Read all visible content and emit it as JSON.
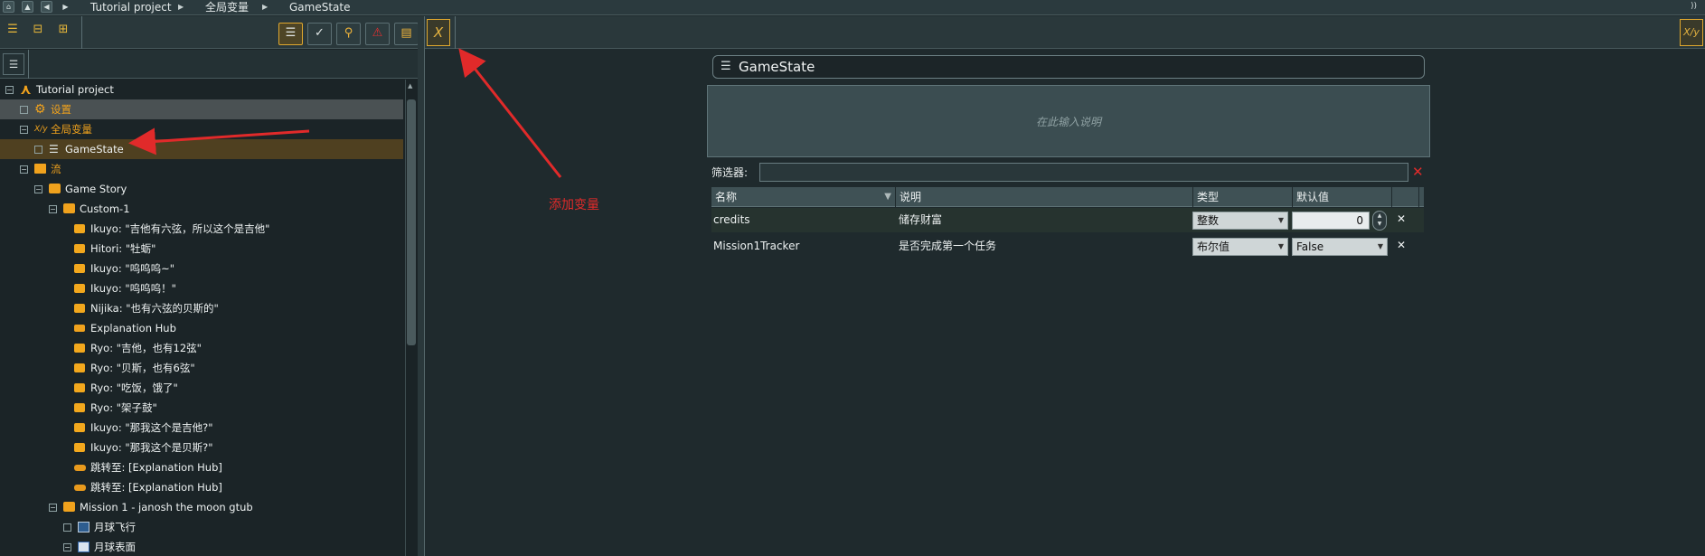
{
  "breadcrumb": {
    "items": [
      "Tutorial project",
      "全局变量",
      "GameState"
    ]
  },
  "left_panel": {
    "tree": [
      {
        "label": "Tutorial project",
        "icon": "project-icon",
        "level": 0,
        "toggle": "−"
      },
      {
        "label": "设置",
        "icon": "gear-icon",
        "level": 1,
        "toggle": "□",
        "style": "sel-a",
        "color": "#f0a21d"
      },
      {
        "label": "全局变量",
        "icon": "variable-icon",
        "level": 1,
        "toggle": "−",
        "color": "#f0a21d"
      },
      {
        "label": "GameState",
        "icon": "list-icon",
        "level": 2,
        "toggle": "□",
        "style": "sel-b"
      },
      {
        "label": "流",
        "icon": "flow-icon",
        "level": 1,
        "toggle": "−",
        "color": "#f0a21d"
      },
      {
        "label": "Game Story",
        "icon": "folder-icon",
        "level": 2,
        "toggle": "−"
      },
      {
        "label": "Custom-1",
        "icon": "folder-icon",
        "level": 3,
        "toggle": "−"
      },
      {
        "label": "Ikuyo: \"吉他有六弦，所以这个是吉他\"",
        "icon": "dialogue-icon",
        "level": 4
      },
      {
        "label": "Hitori: \"牡蛎\"",
        "icon": "dialogue-icon",
        "level": 4
      },
      {
        "label": "Ikuyo: \"呜呜呜~\"",
        "icon": "dialogue-icon",
        "level": 4
      },
      {
        "label": "Ikuyo: \"呜呜呜！\"",
        "icon": "dialogue-icon",
        "level": 4
      },
      {
        "label": "Nijika: \"也有六弦的贝斯的\"",
        "icon": "dialogue-icon",
        "level": 4
      },
      {
        "label": "Explanation Hub",
        "icon": "hub-icon",
        "level": 4
      },
      {
        "label": "Ryo: \"吉他，也有12弦\"",
        "icon": "dialogue-icon",
        "level": 4
      },
      {
        "label": "Ryo: \"贝斯，也有6弦\"",
        "icon": "dialogue-icon",
        "level": 4
      },
      {
        "label": "Ryo: \"吃饭，饿了\"",
        "icon": "dialogue-icon",
        "level": 4
      },
      {
        "label": "Ryo: \"架子鼓\"",
        "icon": "dialogue-icon",
        "level": 4
      },
      {
        "label": "Ikuyo: \"那我这个是吉他?\"",
        "icon": "dialogue-icon",
        "level": 4
      },
      {
        "label": "Ikuyo: \"那我这个是贝斯?\"",
        "icon": "dialogue-icon",
        "level": 4
      },
      {
        "label": "跳转至:   [Explanation Hub]",
        "icon": "jump-icon",
        "level": 4
      },
      {
        "label": "跳转至:   [Explanation Hub]",
        "icon": "jump-icon",
        "level": 4
      },
      {
        "label": "Mission 1 - janosh the moon gtub",
        "icon": "folder-icon",
        "level": 3,
        "toggle": "−"
      },
      {
        "label": "月球飞行",
        "icon": "image-icon",
        "level": 4,
        "toggle": "□"
      },
      {
        "label": "月球表面",
        "icon": "flag-icon",
        "level": 4,
        "toggle": "−"
      }
    ]
  },
  "editor": {
    "title": "GameState",
    "description_placeholder": "在此输入说明",
    "filter_label": "筛选器:",
    "filter_value": "",
    "columns": [
      "名称",
      "说明",
      "类型",
      "默认值"
    ],
    "rows": [
      {
        "name": "credits",
        "description": "储存财富",
        "type": "整数",
        "default": "0",
        "default_kind": "number"
      },
      {
        "name": "Mission1Tracker",
        "description": "是否完成第一个任务",
        "type": "布尔值",
        "default": "False",
        "default_kind": "combo"
      }
    ]
  },
  "annotation": {
    "text": "添加变量",
    "color": "#e12a2a"
  },
  "colors": {
    "accent": "#e0a82e",
    "folder": "#f0a21d",
    "delete": "#e02b2b"
  }
}
